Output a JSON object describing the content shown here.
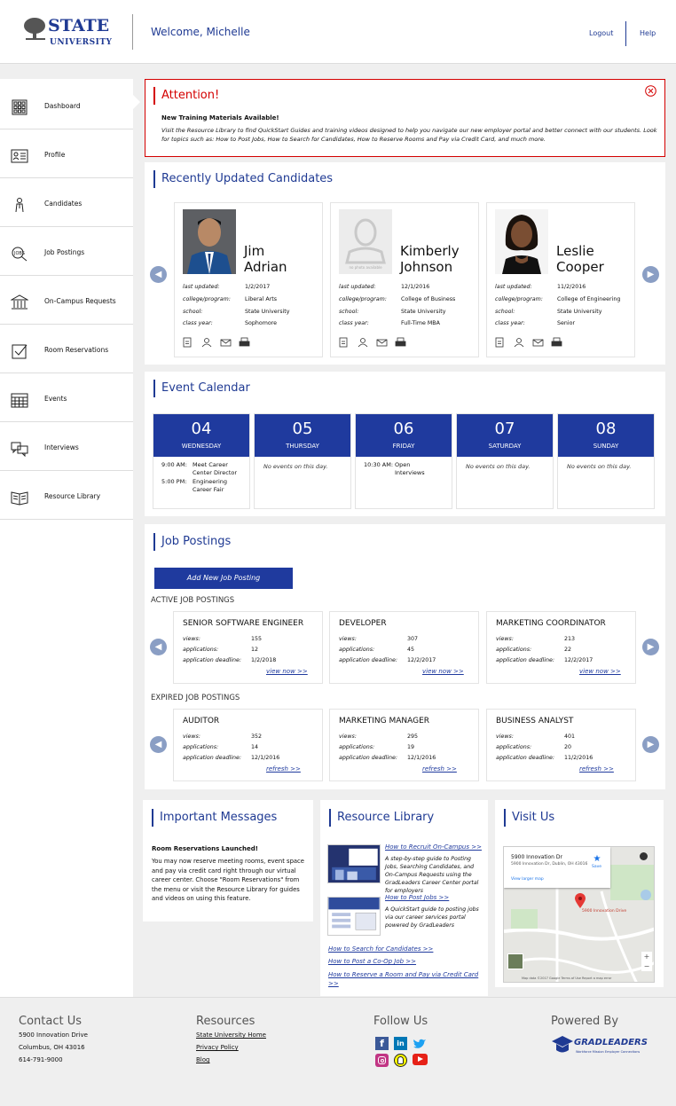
{
  "header": {
    "logo_line1": "STATE",
    "logo_line2": "UNIVERSITY",
    "welcome": "Welcome, Michelle",
    "logout": "Logout",
    "help": "Help"
  },
  "sidebar": {
    "items": [
      {
        "label": "Dashboard",
        "icon": "dashboard-icon"
      },
      {
        "label": "Profile",
        "icon": "profile-icon"
      },
      {
        "label": "Candidates",
        "icon": "candidates-icon"
      },
      {
        "label": "Job Postings",
        "icon": "job-postings-icon"
      },
      {
        "label": "On-Campus Requests",
        "icon": "building-icon"
      },
      {
        "label": "Room Reservations",
        "icon": "checkbox-icon"
      },
      {
        "label": "Events",
        "icon": "calendar-icon"
      },
      {
        "label": "Interviews",
        "icon": "chat-icon"
      },
      {
        "label": "Resource Library",
        "icon": "book-icon"
      }
    ]
  },
  "attention": {
    "title": "Attention!",
    "subtitle": "New Training Materials Available!",
    "body": "Visit the Resource Library to find QuickStart Guides and training videos designed to help you navigate our new employer portal and better connect with our students. Look for topics such as: How to Post Jobs, How to Search for Candidates, How to Reserve Rooms and Pay via Credit Card, and much more."
  },
  "candidates": {
    "title": "Recently Updated Candidates",
    "labels": {
      "last_updated": "last updated:",
      "college": "college/program:",
      "school": "school:",
      "class_year": "class year:"
    },
    "no_photo": "no photo available",
    "items": [
      {
        "first": "Jim",
        "last": "Adrian",
        "last_updated": "1/2/2017",
        "college": "Liberal Arts",
        "school": "State University",
        "class_year": "Sophomore"
      },
      {
        "first": "Kimberly",
        "last": "Johnson",
        "last_updated": "12/1/2016",
        "college": "College of Business",
        "school": "State University",
        "class_year": "Full-Time MBA"
      },
      {
        "first": "Leslie",
        "last": "Cooper",
        "last_updated": "11/2/2016",
        "college": "College of Engineering",
        "school": "State University",
        "class_year": "Senior"
      }
    ]
  },
  "calendar": {
    "title": "Event Calendar",
    "no_events": "No events on this day.",
    "days": [
      {
        "num": "04",
        "name": "WEDNESDAY"
      },
      {
        "num": "05",
        "name": "THURSDAY"
      },
      {
        "num": "06",
        "name": "FRIDAY"
      },
      {
        "num": "07",
        "name": "SATURDAY"
      },
      {
        "num": "08",
        "name": "SUNDAY"
      }
    ],
    "events": {
      "d0_t1": "9:00 AM:",
      "d0_e1": "Meet Career Center Director",
      "d0_t2": "5:00 PM:",
      "d0_e2": "Engineering Career Fair",
      "d2_t1": "10:30 AM:",
      "d2_e1": "Open Interviews"
    }
  },
  "jobs": {
    "title": "Job Postings",
    "add_button": "Add New Job Posting",
    "active_label": "ACTIVE JOB POSTINGS",
    "expired_label": "EXPIRED JOB POSTINGS",
    "labels": {
      "views": "views:",
      "applications": "applications:",
      "deadline": "application deadline:"
    },
    "active": [
      {
        "title": "SENIOR SOFTWARE ENGINEER",
        "views": "155",
        "applications": "12",
        "deadline": "1/2/2018",
        "link": "view now >>"
      },
      {
        "title": "DEVELOPER",
        "views": "307",
        "applications": "45",
        "deadline": "12/2/2017",
        "link": "view now >>"
      },
      {
        "title": "MARKETING COORDINATOR",
        "views": "213",
        "applications": "22",
        "deadline": "12/2/2017",
        "link": "view now >>"
      }
    ],
    "expired": [
      {
        "title": "AUDITOR",
        "views": "352",
        "applications": "14",
        "deadline": "12/1/2016",
        "link": "refresh >>"
      },
      {
        "title": "MARKETING MANAGER",
        "views": "295",
        "applications": "19",
        "deadline": "12/1/2016",
        "link": "refresh >>"
      },
      {
        "title": "BUSINESS ANALYST",
        "views": "401",
        "applications": "20",
        "deadline": "11/2/2016",
        "link": "refresh >>"
      }
    ]
  },
  "messages": {
    "title": "Important Messages",
    "heading": "Room Reservations Launched!",
    "body": "You may now reserve meeting rooms, event space and pay via credit card right through our virtual career center. Choose \"Room Reservations\" from the menu or visit the Resource Library for guides and videos on using this feature."
  },
  "library": {
    "title": "Resource Library",
    "item1_link": "How to Recruit On-Campus >>",
    "item1_desc": "A step-by-step guide to Posting Jobs, Searching Candidates, and On-Campus Requests using the GradLeaders Career Center portal for employers",
    "item2_link": "How to Post Jobs >>",
    "item2_desc": "A QuickStart guide to posting jobs via our career services portal powered by GradLeaders",
    "link3": "How to Search for Candidates >>",
    "link4": "How to Post a Co-Op Job >>",
    "link5": "How to Reserve a Room and Pay via Credit Card >>"
  },
  "visit": {
    "title": "Visit Us",
    "map_address": "5900 Innovation Dr",
    "map_sub": "5900 Innovation Dr, Dublin, OH 43016",
    "map_view": "View larger map",
    "map_save": "Save",
    "map_pin": "5900 Innovation Drive",
    "map_footer": "Map data ©2017 Google  Terms of Use  Report a map error"
  },
  "footer": {
    "contact_title": "Contact Us",
    "contact_line1": "5900 Innovation Drive",
    "contact_line2": "Columbus, OH 43016",
    "contact_line3": "614-791-9000",
    "resources_title": "Resources",
    "res1": "State University Home",
    "res2": "Privacy Policy",
    "res3": "Blog",
    "follow_title": "Follow Us",
    "powered_title": "Powered By",
    "powered_name": "GRADLEADERS",
    "powered_tag": "Workforce Mission Employer Connections"
  }
}
